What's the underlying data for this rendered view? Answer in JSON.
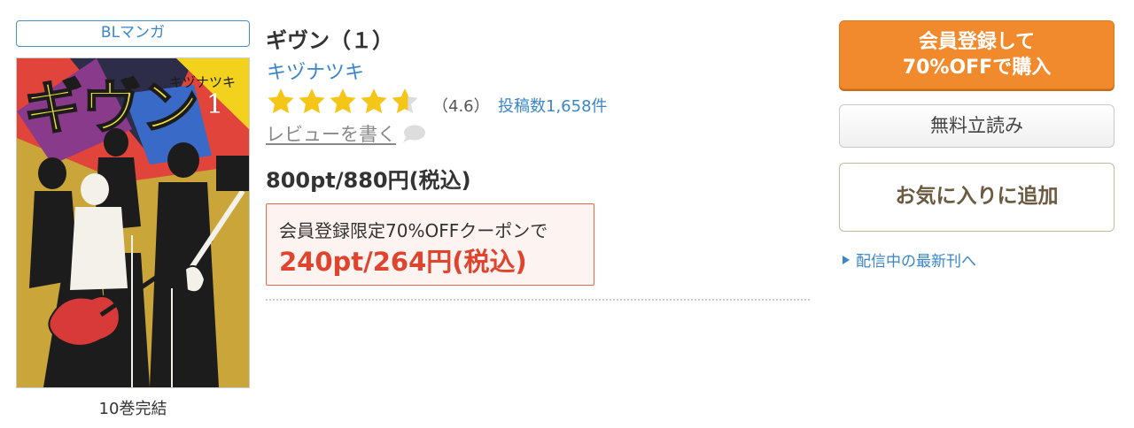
{
  "genre": {
    "label": "BLマンガ"
  },
  "cover": {
    "title_text": "ギヴン",
    "author_text": "キヅナツキ",
    "volume_text": "1",
    "colors": {
      "bg": "#c9a53a",
      "dark": "#1c1c1c",
      "red": "#d83a3a",
      "yellow": "#f2d21c"
    }
  },
  "volumes_note": "10巻完結",
  "book": {
    "title": "ギヴン（１）",
    "author": "キヅナツキ",
    "rating": 4.6,
    "rating_max": 5,
    "rating_text": "（4.6）",
    "review_count": "投稿数1,658件",
    "write_review": "レビューを書く",
    "price": "800pt/880円(税込)"
  },
  "coupon": {
    "label": "会員登録限定70%OFFクーポンで",
    "price": "240pt/264円(税込)"
  },
  "actions": {
    "buy_line1": "会員登録して",
    "buy_line2": "70%OFFで購入",
    "free_read": "無料立読み",
    "favorite": "お気に入りに追加",
    "latest": "配信中の最新刊へ"
  },
  "colors": {
    "link": "#3a86c8",
    "star": "#f5c518",
    "star_empty": "#dddddd",
    "buy_button": "#f08a2c",
    "coupon_price": "#e0442e"
  }
}
